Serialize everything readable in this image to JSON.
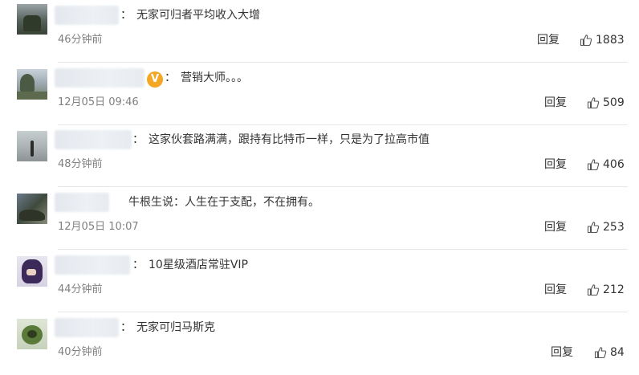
{
  "comments": [
    {
      "text": "无家可归者平均收入大增",
      "time": "46分钟前",
      "reply": "回复",
      "likes": "1883"
    },
    {
      "text": "营销大师。。。",
      "time": "12月05日 09:46",
      "reply": "回复",
      "likes": "509",
      "badge": "V"
    },
    {
      "text": "这家伙套路满满，跟持有比特币一样，只是为了拉高市值",
      "time": "48分钟前",
      "reply": "回复",
      "likes": "406"
    },
    {
      "text": "牛根生说：人生在于支配，不在拥有。",
      "time": "12月05日 10:07",
      "reply": "回复",
      "likes": "253"
    },
    {
      "text": "10星级酒店常驻VIP",
      "time": "44分钟前",
      "reply": "回复",
      "likes": "212"
    },
    {
      "text": "无家可归马斯克",
      "time": "40分钟前",
      "reply": "回复",
      "likes": "84"
    }
  ],
  "colon": "：",
  "icons": {
    "like": "thumbs-up-icon",
    "verified": "verified-v-icon"
  },
  "colors": {
    "text": "#333333",
    "time": "#808080",
    "badge": "#f5a623",
    "divider": "#e6e6e6"
  }
}
